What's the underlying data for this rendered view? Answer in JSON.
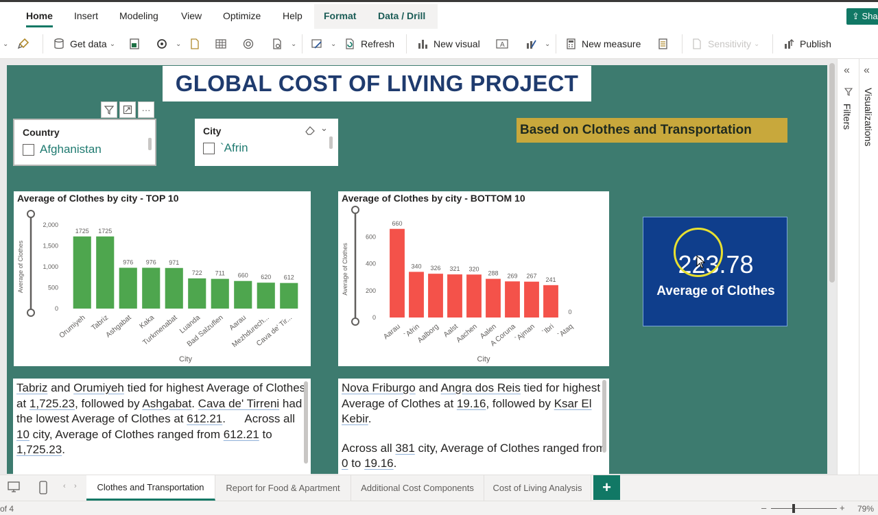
{
  "menu": {
    "tabs": [
      "Home",
      "Insert",
      "Modeling",
      "View",
      "Optimize",
      "Help",
      "Format",
      "Data / Drill"
    ],
    "share_label": "Sha"
  },
  "toolbar": {
    "get_data": "Get data",
    "refresh": "Refresh",
    "new_visual": "New visual",
    "new_measure": "New measure",
    "sensitivity": "Sensitivity",
    "publish": "Publish"
  },
  "report": {
    "title": "GLOBAL COST OF LIVING PROJECT",
    "subtitle": "Based on Clothes and Transportation"
  },
  "slicers": {
    "country": {
      "title": "Country",
      "option": "Afghanistan"
    },
    "city": {
      "title": "City",
      "option": "`Afrin"
    }
  },
  "chart_data": [
    {
      "type": "bar",
      "title": "Average of Clothes by city - TOP 10",
      "xlabel": "City",
      "ylabel": "Average of Clothes",
      "categories": [
        "Orumiyeh",
        "Tabriz",
        "Ashgabat",
        "Kaka",
        "Turkmenabat",
        "Luanda",
        "Bad Salzuflen",
        "Aarau",
        "Mezhdurech...",
        "Cava de' Tir..."
      ],
      "values": [
        1725,
        1725,
        976,
        976,
        971,
        722,
        711,
        660,
        620,
        612
      ],
      "data_labels": [
        "1725",
        "1725",
        "976",
        "976",
        "971",
        "722",
        "711",
        "660",
        "620",
        "612"
      ],
      "yticks": [
        0,
        500,
        1000,
        1500,
        2000
      ],
      "ytick_labels": [
        "0",
        "500",
        "1,000",
        "1,500",
        "2,000"
      ],
      "ylim": [
        0,
        2000
      ],
      "color": "#4ea64e"
    },
    {
      "type": "bar",
      "title": "Average of Clothes by city - BOTTOM 10",
      "xlabel": "City",
      "ylabel": "Average of Clothes",
      "categories": [
        "Aarau",
        "`Afrin",
        "Aalborg",
        "Aalst",
        "Aachen",
        "Aalen",
        "A Coruna",
        "`Ajman",
        "`Ibri",
        "`Ataq"
      ],
      "values": [
        660,
        340,
        326,
        321,
        320,
        288,
        269,
        267,
        241,
        0
      ],
      "data_labels": [
        "660",
        "340",
        "326",
        "321",
        "320",
        "288",
        "269",
        "267",
        "241",
        "0"
      ],
      "yticks": [
        0,
        200,
        400,
        600
      ],
      "ytick_labels": [
        "0",
        "200",
        "400",
        "600"
      ],
      "ylim": [
        0,
        720
      ],
      "color": "#f4524a"
    }
  ],
  "kpi": {
    "value": "223.78",
    "label": "Average of Clothes"
  },
  "narratives": {
    "left": {
      "p1_a": "Tabriz",
      "p1_b": " and ",
      "p1_c": "Orumiyeh",
      "p1_d": " tied for highest Average of Clothes at ",
      "p1_e": "1,725.23",
      "p1_f": ", followed by ",
      "p1_g": "Ashgabat",
      "p1_h": ". ",
      "p1_i": "Cava de' Tirreni",
      "p1_j": " had the lowest Average of Clothes at ",
      "p1_k": "612.21",
      "p1_l": ".      Across all ",
      "p1_m": "10",
      "p1_n": " city, Average of Clothes ranged from ",
      "p1_o": "612.21",
      "p1_p": " to ",
      "p1_q": "1,725.23",
      "p1_r": "."
    },
    "right": {
      "p1_a": "Nova Friburgo",
      "p1_b": " and ",
      "p1_c": "Angra dos Reis",
      "p1_d": " tied for highest Average of Clothes at ",
      "p1_e": "19.16",
      "p1_f": ", followed by ",
      "p1_g": "Ksar El Kebir",
      "p1_h": ".",
      "p2_a": "Across all ",
      "p2_b": "381",
      "p2_c": " city, Average of Clothes ranged from ",
      "p2_d": "0",
      "p2_e": " to ",
      "p2_f": "19.16",
      "p2_g": "."
    }
  },
  "panes": {
    "filters": "Filters",
    "visualizations": "Visualizations"
  },
  "pages": {
    "tabs": [
      "Clothes and Transportation",
      "Report for Food & Apartment",
      "Additional Cost Components",
      "Cost of Living Analysis"
    ],
    "active": 0,
    "add_label": "+"
  },
  "status": {
    "page_count": "of 4",
    "zoom": "79%",
    "zoom_percent": 79
  }
}
